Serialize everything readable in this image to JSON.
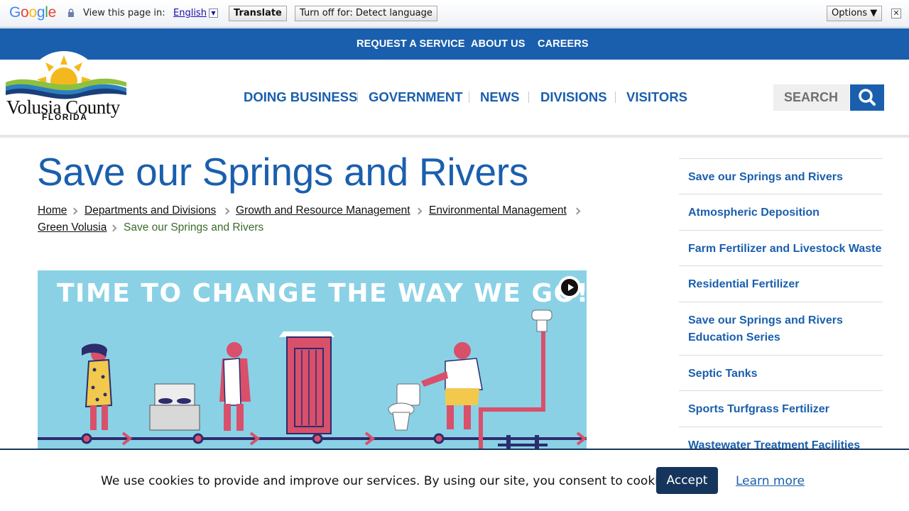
{
  "google_bar": {
    "logo": [
      "G",
      "o",
      "o",
      "g",
      "l",
      "e"
    ],
    "view_text": "View this page in:",
    "language": "English",
    "translate_label": "Translate",
    "turn_off_label": "Turn off for: Detect language",
    "options_label": "Options ▼",
    "close_label": "✕"
  },
  "top_nav": [
    "REQUEST A SERVICE",
    "ABOUT US",
    "CAREERS"
  ],
  "logo": {
    "name": "Volusia County",
    "state": "FLORIDA"
  },
  "main_nav": [
    "DOING BUSINESS",
    "GOVERNMENT",
    "NEWS",
    "DIVISIONS",
    "VISITORS"
  ],
  "search": {
    "placeholder": "SEARCH"
  },
  "page": {
    "title": "Save our Springs and Rivers"
  },
  "breadcrumb": {
    "links": [
      "Home",
      "Departments and Divisions",
      "Growth and Resource Management",
      "Environmental Management",
      "Green Volusia"
    ],
    "current": "Save our Springs and Rivers"
  },
  "hero": {
    "text": "TIME TO CHANGE THE WAY WE GO!"
  },
  "sidebar": [
    "Save our Springs and Rivers",
    "Atmospheric Deposition",
    "Farm Fertilizer and Livestock Waste",
    "Residential Fertilizer",
    "Save our Springs and Rivers Education Series",
    "Septic Tanks",
    "Sports Turfgrass Fertilizer",
    "Wastewater Treatment Facilities and"
  ],
  "cookie": {
    "text": "We use cookies to provide and improve our services. By using our site, you consent to cookies.",
    "accept_label": "Accept",
    "learn_label": "Learn more"
  },
  "colors": {
    "brand_blue": "#1a5fad",
    "navy": "#16355c",
    "hero_bg": "#8ad1e6"
  }
}
